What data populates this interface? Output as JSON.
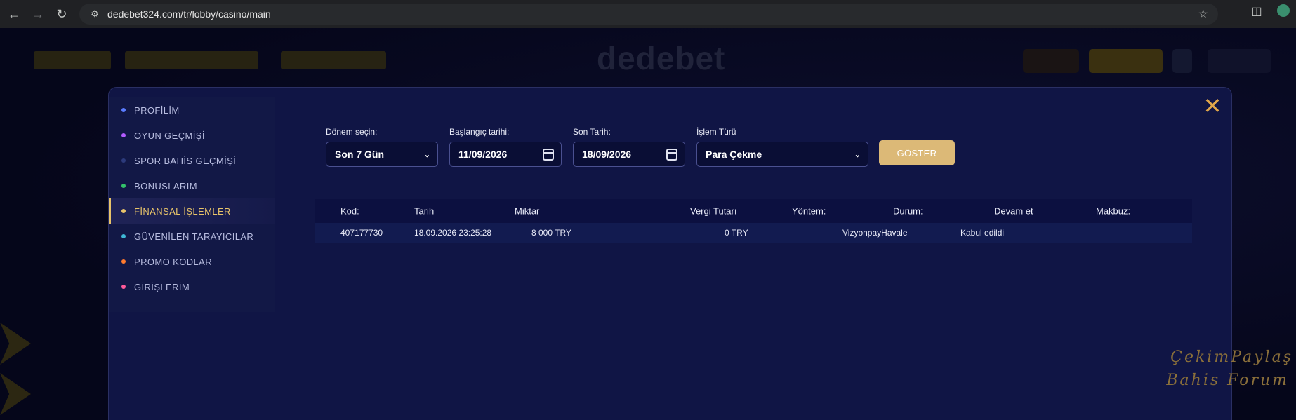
{
  "browser": {
    "url": "dedebet324.com/tr/lobby/casino/main"
  },
  "site": {
    "logo": "dedebet"
  },
  "sidebar": {
    "items": [
      {
        "label": "PROFİLİM",
        "dot_color": "#5a7cff"
      },
      {
        "label": "OYUN GEÇMİŞİ",
        "dot_color": "#b35cff"
      },
      {
        "label": "SPOR BAHİS GEÇMİŞİ",
        "dot_color": "#2c3a7c"
      },
      {
        "label": "BONUSLARIM",
        "dot_color": "#33c26a"
      },
      {
        "label": "FİNANSAL İŞLEMLER",
        "dot_color": "#e8c46a",
        "active": true
      },
      {
        "label": "GÜVENİLEN TARAYICILAR",
        "dot_color": "#3fb8d6"
      },
      {
        "label": "PROMO KODLAR",
        "dot_color": "#ff7a2e"
      },
      {
        "label": "GİRİŞLERİM",
        "dot_color": "#ff5a9a"
      }
    ]
  },
  "filters": {
    "period_label": "Dönem seçin:",
    "period_value": "Son 7 Gün",
    "start_label": "Başlangıç tarihi:",
    "start_value": "11/09/2026",
    "end_label": "Son Tarih:",
    "end_value": "18/09/2026",
    "type_label": "İşlem Türü",
    "type_value": "Para Çekme",
    "show_button": "GÖSTER"
  },
  "table": {
    "headers": [
      "Kod:",
      "Tarih",
      "Miktar",
      "Vergi Tutarı",
      "Yöntem:",
      "Durum:",
      "Devam et",
      "Makbuz:"
    ],
    "rows": [
      {
        "kod": "407177730",
        "tarih": "18.09.2026 23:25:28",
        "miktar": "8 000 TRY",
        "vergi": "0 TRY",
        "yontem": "VizyonpayHavale",
        "durum": "Kabul edildi"
      }
    ]
  },
  "watermark": {
    "line1": "ÇekimPaylaş",
    "line2": "Bahis Forum"
  },
  "colors": {
    "accent_gold": "#e8c46a",
    "modal_bg": "#101545",
    "button_gold": "#dcb977"
  }
}
